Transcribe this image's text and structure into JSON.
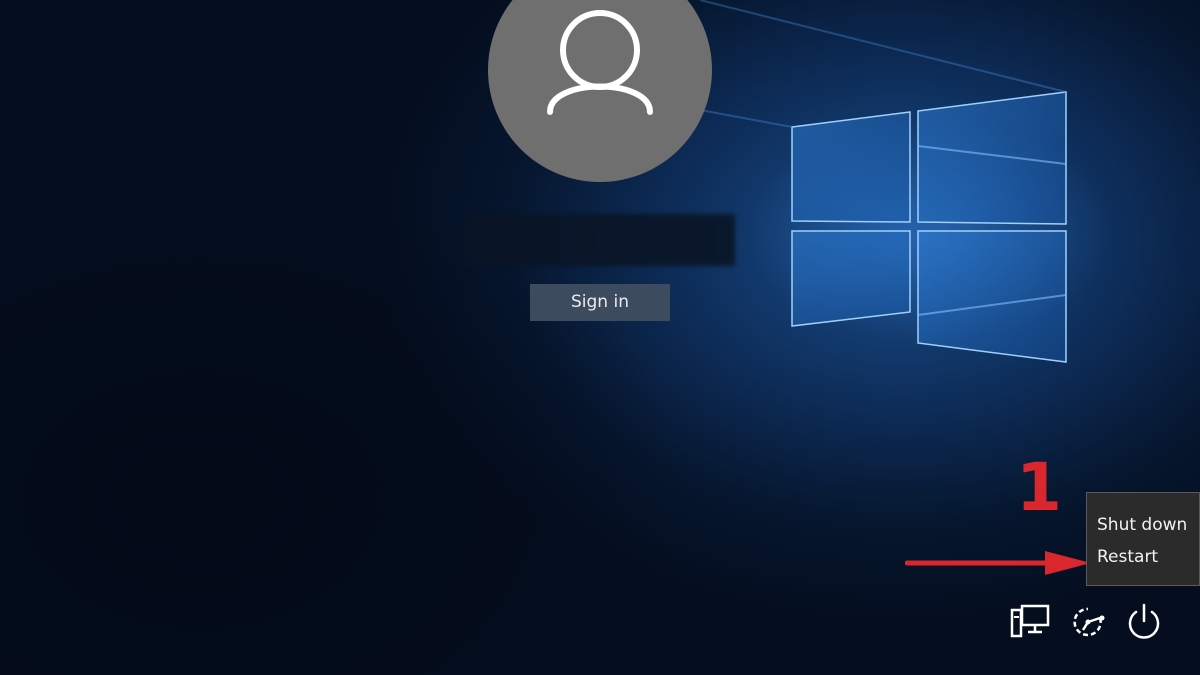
{
  "login": {
    "username": "",
    "signin_label": "Sign in"
  },
  "power_menu": {
    "items": [
      {
        "label": "Shut down"
      },
      {
        "label": "Restart"
      }
    ]
  },
  "annotation": {
    "number": "1",
    "color": "#d9272e"
  },
  "tray": {
    "icons": [
      "network-icon",
      "ease-of-access-icon",
      "power-icon"
    ]
  },
  "colors": {
    "background": "#06162e",
    "accent": "#1a4f8f",
    "avatar": "#6f6f6f",
    "button": "#3d4b5e",
    "menu": "#2b2b2b"
  }
}
